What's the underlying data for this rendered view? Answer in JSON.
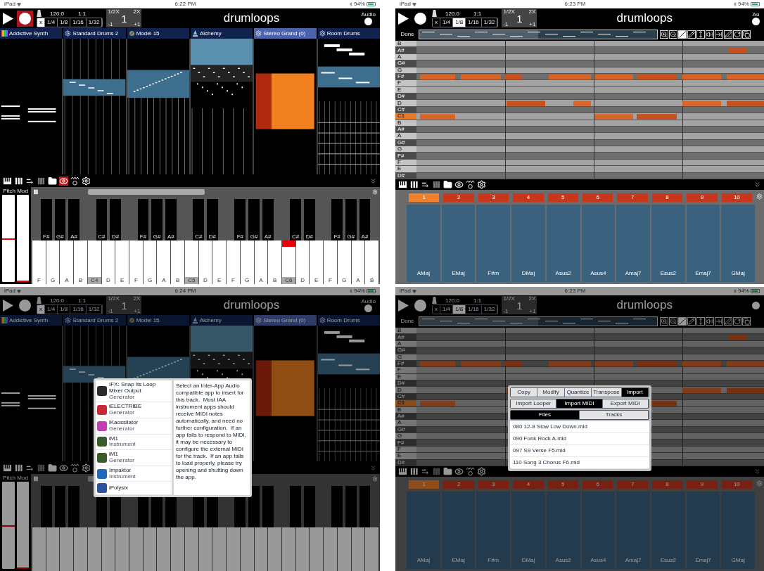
{
  "screens": [
    {
      "kind": "tracks",
      "dimmed": false,
      "status": {
        "device": "iPad",
        "time": "6:22 PM",
        "battery": "94%"
      },
      "toolbar": {
        "recording": true,
        "tempo": "120.0",
        "position": "1:1",
        "grid": [
          {
            "label": "x",
            "selected": true
          },
          {
            "label": "1/4",
            "selected": false
          },
          {
            "label": "1/8",
            "selected": false
          },
          {
            "label": "1/16",
            "selected": false
          },
          {
            "label": "1/32",
            "selected": false
          }
        ],
        "multiplier": {
          "half": "1/2X",
          "double": "2X",
          "value": "1",
          "minus": "-1",
          "plus": "+1"
        },
        "title": "drumloops",
        "audio": "Audio"
      },
      "tracks": [
        {
          "name": "Addictive Synth",
          "kind": "spectrum",
          "selected": false
        },
        {
          "name": "Standard Drums 2",
          "kind": "gear",
          "selected": false
        },
        {
          "name": "Model 15",
          "kind": "dial",
          "selected": false
        },
        {
          "name": "Alchemy",
          "kind": "figure",
          "selected": false
        },
        {
          "name": "Stereo Grand (0)",
          "kind": "gear",
          "selected": true
        },
        {
          "name": "Room Drums",
          "kind": "gear",
          "selected": false
        }
      ],
      "view_icons": [
        {
          "kind": "keys",
          "active": false
        },
        {
          "kind": "bars",
          "active": false
        },
        {
          "kind": "list",
          "active": false
        },
        {
          "kind": "grid",
          "active": false
        },
        {
          "kind": "folder",
          "active": false
        },
        {
          "kind": "wave-eye",
          "active": true
        },
        {
          "kind": "wave-ring",
          "active": false
        },
        {
          "kind": "gear",
          "active": false
        }
      ],
      "keyboard": {
        "pitch": {
          "label": "Pitch",
          "level": 0.5
        },
        "mod": {
          "label": "Mod",
          "level": 0
        },
        "keys": [
          {
            "kind": "white",
            "label": "F",
            "marked": false,
            "pressed": false
          },
          {
            "kind": "black",
            "label": "F#"
          },
          {
            "kind": "white",
            "label": "G",
            "marked": false,
            "pressed": false
          },
          {
            "kind": "black",
            "label": "G#"
          },
          {
            "kind": "white",
            "label": "A",
            "marked": false,
            "pressed": false
          },
          {
            "kind": "black",
            "label": "A#"
          },
          {
            "kind": "white",
            "label": "B",
            "marked": false,
            "pressed": false
          },
          {
            "kind": "white",
            "label": "C4",
            "marked": true,
            "pressed": false
          },
          {
            "kind": "black",
            "label": "C#"
          },
          {
            "kind": "white",
            "label": "D",
            "marked": false,
            "pressed": false
          },
          {
            "kind": "black",
            "label": "D#"
          },
          {
            "kind": "white",
            "label": "E",
            "marked": false,
            "pressed": false
          },
          {
            "kind": "white",
            "label": "F",
            "marked": false,
            "pressed": false
          },
          {
            "kind": "black",
            "label": "F#"
          },
          {
            "kind": "white",
            "label": "G",
            "marked": false,
            "pressed": false
          },
          {
            "kind": "black",
            "label": "G#"
          },
          {
            "kind": "white",
            "label": "A",
            "marked": false,
            "pressed": false
          },
          {
            "kind": "black",
            "label": "A#"
          },
          {
            "kind": "white",
            "label": "B",
            "marked": false,
            "pressed": false
          },
          {
            "kind": "white",
            "label": "C5",
            "marked": true,
            "pressed": false
          },
          {
            "kind": "black",
            "label": "C#"
          },
          {
            "kind": "white",
            "label": "D",
            "marked": false,
            "pressed": false
          },
          {
            "kind": "black",
            "label": "D#"
          },
          {
            "kind": "white",
            "label": "E",
            "marked": false,
            "pressed": false
          },
          {
            "kind": "white",
            "label": "F",
            "marked": false,
            "pressed": false
          },
          {
            "kind": "black",
            "label": "F#"
          },
          {
            "kind": "white",
            "label": "G",
            "marked": false,
            "pressed": false
          },
          {
            "kind": "black",
            "label": "G#"
          },
          {
            "kind": "white",
            "label": "A",
            "marked": false,
            "pressed": false
          },
          {
            "kind": "black",
            "label": "A#"
          },
          {
            "kind": "white",
            "label": "B",
            "marked": false,
            "pressed": false
          },
          {
            "kind": "white",
            "label": "C6",
            "marked": true,
            "pressed": true
          },
          {
            "kind": "black",
            "label": "C#"
          },
          {
            "kind": "white",
            "label": "D",
            "marked": false,
            "pressed": false
          },
          {
            "kind": "black",
            "label": "D#"
          },
          {
            "kind": "white",
            "label": "E",
            "marked": false,
            "pressed": false
          },
          {
            "kind": "white",
            "label": "F",
            "marked": false,
            "pressed": false
          },
          {
            "kind": "black",
            "label": "F#"
          },
          {
            "kind": "white",
            "label": "G",
            "marked": false,
            "pressed": false
          },
          {
            "kind": "black",
            "label": "G#"
          },
          {
            "kind": "white",
            "label": "A",
            "marked": false,
            "pressed": false
          },
          {
            "kind": "black",
            "label": "A#"
          },
          {
            "kind": "white",
            "label": "B",
            "marked": false,
            "pressed": false
          }
        ]
      }
    },
    {
      "kind": "roll",
      "dimmed": false,
      "status": {
        "device": "iPad",
        "time": "6:23 PM",
        "battery": "94%"
      },
      "toolbar": {
        "recording": false,
        "tempo": "120.0",
        "position": "1:1",
        "grid": [
          {
            "label": "x",
            "selected": false
          },
          {
            "label": "1/4",
            "selected": false
          },
          {
            "label": "1/8",
            "selected": true
          },
          {
            "label": "1/16",
            "selected": false
          },
          {
            "label": "1/32",
            "selected": false
          }
        ],
        "multiplier": {
          "half": "1/2X",
          "double": "2X",
          "value": "1",
          "minus": "-1",
          "plus": "+1"
        },
        "title": "drumloops",
        "audio": "Au"
      },
      "done": "Done",
      "tools": [
        {
          "kind": "zoom-in",
          "selected": false
        },
        {
          "kind": "zoom-out",
          "selected": false
        },
        {
          "kind": "line",
          "selected": true
        },
        {
          "kind": "pencil",
          "selected": false
        },
        {
          "kind": "vertical",
          "selected": false
        },
        {
          "kind": "waves",
          "selected": false
        },
        {
          "kind": "to-line",
          "selected": false
        },
        {
          "kind": "pen",
          "selected": false
        },
        {
          "kind": "rotate",
          "selected": false
        },
        {
          "kind": "copy",
          "selected": false
        }
      ],
      "rows": [
        {
          "label": "B",
          "kind": "natural",
          "highlighted": false
        },
        {
          "label": "A#",
          "kind": "sharp",
          "highlighted": false
        },
        {
          "label": "A",
          "kind": "natural",
          "highlighted": false
        },
        {
          "label": "G#",
          "kind": "sharp",
          "highlighted": false
        },
        {
          "label": "G",
          "kind": "natural",
          "highlighted": false
        },
        {
          "label": "F#",
          "kind": "sharp",
          "highlighted": false
        },
        {
          "label": "F",
          "kind": "natural",
          "highlighted": false
        },
        {
          "label": "E",
          "kind": "natural",
          "highlighted": false
        },
        {
          "label": "D#",
          "kind": "sharp",
          "highlighted": false
        },
        {
          "label": "D",
          "kind": "natural",
          "highlighted": false
        },
        {
          "label": "C#",
          "kind": "sharp",
          "highlighted": false
        },
        {
          "label": "C1",
          "kind": "natural",
          "highlighted": true
        },
        {
          "label": "B",
          "kind": "natural",
          "highlighted": false
        },
        {
          "label": "A#",
          "kind": "sharp",
          "highlighted": false
        },
        {
          "label": "A",
          "kind": "natural",
          "highlighted": false
        },
        {
          "label": "G#",
          "kind": "sharp",
          "highlighted": false
        },
        {
          "label": "G",
          "kind": "natural",
          "highlighted": false
        },
        {
          "label": "F#",
          "kind": "sharp",
          "highlighted": false
        },
        {
          "label": "F",
          "kind": "natural",
          "highlighted": false
        },
        {
          "label": "E",
          "kind": "natural",
          "highlighted": false
        },
        {
          "label": "D#",
          "kind": "sharp",
          "highlighted": false
        }
      ],
      "view_icons": [
        {
          "kind": "keys",
          "active": false
        },
        {
          "kind": "bars",
          "active": false
        },
        {
          "kind": "list",
          "active": false
        },
        {
          "kind": "grid",
          "active": false
        },
        {
          "kind": "folder",
          "active": false
        },
        {
          "kind": "wave-eye",
          "active": false
        },
        {
          "kind": "wave-ring",
          "active": false
        },
        {
          "kind": "gear",
          "active": false
        }
      ],
      "pads": [
        {
          "number": "1",
          "chord": "AMaj",
          "selected": true
        },
        {
          "number": "2",
          "chord": "EMaj",
          "selected": false
        },
        {
          "number": "3",
          "chord": "F#m",
          "selected": false
        },
        {
          "number": "4",
          "chord": "DMaj",
          "selected": false
        },
        {
          "number": "5",
          "chord": "Asus2",
          "selected": false
        },
        {
          "number": "6",
          "chord": "Asus4",
          "selected": false
        },
        {
          "number": "7",
          "chord": "Amaj7",
          "selected": false
        },
        {
          "number": "8",
          "chord": "Esus2",
          "selected": false
        },
        {
          "number": "9",
          "chord": "Emaj7",
          "selected": false
        },
        {
          "number": "10",
          "chord": "GMaj",
          "selected": false
        }
      ]
    },
    {
      "kind": "tracks",
      "dimmed": true,
      "status": {
        "device": "iPad",
        "time": "6:24 PM",
        "battery": "94%"
      },
      "toolbar": {
        "recording": false,
        "tempo": "120.0",
        "position": "1:1",
        "grid": [
          {
            "label": "x",
            "selected": true
          },
          {
            "label": "1/4",
            "selected": false
          },
          {
            "label": "1/8",
            "selected": false
          },
          {
            "label": "1/16",
            "selected": false
          },
          {
            "label": "1/32",
            "selected": false
          }
        ],
        "multiplier": {
          "half": "1/2X",
          "double": "2X",
          "value": "1",
          "minus": "-1",
          "plus": "+1"
        },
        "title": "drumloops",
        "audio": "Audio"
      },
      "tracks": [
        {
          "name": "Addictive Synth",
          "kind": "spectrum",
          "selected": false
        },
        {
          "name": "Standard Drums 2",
          "kind": "gear",
          "selected": false
        },
        {
          "name": "Model 15",
          "kind": "dial",
          "selected": false
        },
        {
          "name": "Alchemy",
          "kind": "figure",
          "selected": false
        },
        {
          "name": "Stereo Grand (0)",
          "kind": "gear",
          "selected": true
        },
        {
          "name": "Room Drums",
          "kind": "gear",
          "selected": false
        }
      ],
      "view_icons": [
        {
          "kind": "keys",
          "active": false
        },
        {
          "kind": "bars",
          "active": false
        },
        {
          "kind": "list",
          "active": false
        },
        {
          "kind": "grid",
          "active": false
        },
        {
          "kind": "folder",
          "active": false
        },
        {
          "kind": "wave-eye",
          "active": false
        },
        {
          "kind": "wave-ring",
          "active": false
        },
        {
          "kind": "gear",
          "active": false
        }
      ],
      "keyboard": {
        "pitch": {
          "label": "Pitch",
          "level": 0.5
        },
        "mod": {
          "label": "Mod",
          "level": 0
        },
        "keys": [
          {
            "kind": "white",
            "marked": false,
            "pressed": false
          },
          {
            "kind": "black"
          },
          {
            "kind": "white",
            "marked": false,
            "pressed": false
          },
          {
            "kind": "black"
          },
          {
            "kind": "white",
            "marked": false,
            "pressed": false
          },
          {
            "kind": "black"
          },
          {
            "kind": "white",
            "marked": false,
            "pressed": false
          },
          {
            "kind": "white",
            "marked": false,
            "pressed": false
          },
          {
            "kind": "black"
          },
          {
            "kind": "white",
            "marked": false,
            "pressed": false
          },
          {
            "kind": "black"
          },
          {
            "kind": "white",
            "marked": false,
            "pressed": false
          },
          {
            "kind": "white",
            "marked": false,
            "pressed": false
          },
          {
            "kind": "black"
          },
          {
            "kind": "white",
            "marked": false,
            "pressed": false
          },
          {
            "kind": "black"
          },
          {
            "kind": "white",
            "marked": false,
            "pressed": false
          },
          {
            "kind": "black"
          },
          {
            "kind": "white",
            "marked": false,
            "pressed": false
          },
          {
            "kind": "white",
            "marked": false,
            "pressed": false
          },
          {
            "kind": "black"
          },
          {
            "kind": "white",
            "marked": false,
            "pressed": false
          },
          {
            "kind": "black"
          },
          {
            "kind": "white",
            "marked": false,
            "pressed": false
          },
          {
            "kind": "white",
            "marked": false,
            "pressed": false
          },
          {
            "kind": "black"
          },
          {
            "kind": "white",
            "marked": false,
            "pressed": false
          },
          {
            "kind": "black"
          },
          {
            "kind": "white",
            "marked": false,
            "pressed": false
          },
          {
            "kind": "black"
          },
          {
            "kind": "white",
            "marked": false,
            "pressed": false
          },
          {
            "kind": "white",
            "marked": false,
            "pressed": false
          },
          {
            "kind": "black"
          },
          {
            "kind": "white",
            "marked": false,
            "pressed": false
          },
          {
            "kind": "black"
          },
          {
            "kind": "white",
            "marked": false,
            "pressed": false
          },
          {
            "kind": "white",
            "marked": false,
            "pressed": false
          },
          {
            "kind": "black"
          },
          {
            "kind": "white",
            "marked": false,
            "pressed": false
          },
          {
            "kind": "black"
          },
          {
            "kind": "white",
            "marked": false,
            "pressed": false
          },
          {
            "kind": "black"
          },
          {
            "kind": "white",
            "marked": false,
            "pressed": false
          }
        ]
      },
      "popup": {
        "kind": "apps",
        "items": [
          {
            "name": "IFX: Snap Its Loop Mixer Output",
            "type": "Generator",
            "color": "#2a2a2a"
          },
          {
            "name": "iELECTRIBE",
            "type": "Generator",
            "color": "#c8283a"
          },
          {
            "name": "iKaossilator",
            "type": "Generator",
            "color": "#c040b0"
          },
          {
            "name": "iM1",
            "type": "Instrument",
            "color": "#3b5a2a"
          },
          {
            "name": "iM1",
            "type": "Generator",
            "color": "#3b5a2a"
          },
          {
            "name": "Impaktor",
            "type": "Instrument",
            "color": "#1e6ab8"
          },
          {
            "name": "iPolysix",
            "color": "#3050a0"
          }
        ],
        "note": "Select an Inter-App Audio compatible app to insert for this track.  Most IAA instrument apps should receive MIDI notes automatically, and need no further configuration.  If an app fails to respond to MIDI, it may be necessary to configure the external MIDI for the track.  If an app fails to load properly, please try opening and shutting down the app."
      }
    },
    {
      "kind": "roll",
      "dimmed": true,
      "status": {
        "device": "iPad",
        "time": "6:23 PM",
        "battery": "94%"
      },
      "toolbar": {
        "recording": false,
        "tempo": "120.0",
        "position": "1:1",
        "grid": [
          {
            "label": "x",
            "selected": false
          },
          {
            "label": "1/4",
            "selected": false
          },
          {
            "label": "1/8",
            "selected": true
          },
          {
            "label": "1/16",
            "selected": false
          },
          {
            "label": "1/32",
            "selected": false
          }
        ],
        "multiplier": {
          "half": "1/2X",
          "double": "2X",
          "value": "1",
          "minus": "-1",
          "plus": "+1"
        },
        "title": "drumloops"
      },
      "done": "Done",
      "tools": [
        {
          "kind": "zoom-in",
          "selected": false
        },
        {
          "kind": "zoom-out",
          "selected": false
        },
        {
          "kind": "line",
          "selected": true
        },
        {
          "kind": "pencil",
          "selected": false
        },
        {
          "kind": "vertical",
          "selected": false
        },
        {
          "kind": "waves",
          "selected": false
        },
        {
          "kind": "to-line",
          "selected": false
        },
        {
          "kind": "pen",
          "selected": false
        },
        {
          "kind": "rotate",
          "selected": false
        },
        {
          "kind": "copy",
          "selected": false
        }
      ],
      "rows": [
        {
          "label": "B",
          "kind": "natural",
          "highlighted": false
        },
        {
          "label": "A#",
          "kind": "sharp",
          "highlighted": false
        },
        {
          "label": "A",
          "kind": "natural",
          "highlighted": false
        },
        {
          "label": "G#",
          "kind": "sharp",
          "highlighted": false
        },
        {
          "label": "G",
          "kind": "natural",
          "highlighted": false
        },
        {
          "label": "F#",
          "kind": "sharp",
          "highlighted": false
        },
        {
          "label": "F",
          "kind": "natural",
          "highlighted": false
        },
        {
          "label": "E",
          "kind": "natural",
          "highlighted": false
        },
        {
          "label": "D#",
          "kind": "sharp",
          "highlighted": false
        },
        {
          "label": "D",
          "kind": "natural",
          "highlighted": false
        },
        {
          "label": "C#",
          "kind": "sharp",
          "highlighted": false
        },
        {
          "label": "C1",
          "kind": "natural",
          "highlighted": true
        },
        {
          "label": "B",
          "kind": "natural",
          "highlighted": false
        },
        {
          "label": "A#",
          "kind": "sharp",
          "highlighted": false
        },
        {
          "label": "A",
          "kind": "natural",
          "highlighted": false
        },
        {
          "label": "G#",
          "kind": "sharp",
          "highlighted": false
        },
        {
          "label": "G",
          "kind": "natural",
          "highlighted": false
        },
        {
          "label": "F#",
          "kind": "sharp",
          "highlighted": false
        },
        {
          "label": "F",
          "kind": "natural",
          "highlighted": false
        },
        {
          "label": "E",
          "kind": "natural",
          "highlighted": false
        },
        {
          "label": "D#",
          "kind": "sharp",
          "highlighted": false
        }
      ],
      "view_icons": [
        {
          "kind": "keys",
          "active": false
        },
        {
          "kind": "bars",
          "active": false
        },
        {
          "kind": "list",
          "active": false
        },
        {
          "kind": "grid",
          "active": false
        },
        {
          "kind": "folder",
          "active": false
        },
        {
          "kind": "wave-eye",
          "active": false
        },
        {
          "kind": "wave-ring",
          "active": false
        },
        {
          "kind": "gear",
          "active": false
        }
      ],
      "pads": [
        {
          "number": "1",
          "chord": "AMaj",
          "selected": true
        },
        {
          "number": "2",
          "chord": "EMaj",
          "selected": false
        },
        {
          "number": "3",
          "chord": "F#m",
          "selected": false
        },
        {
          "number": "4",
          "chord": "DMaj",
          "selected": false
        },
        {
          "number": "5",
          "chord": "Asus2",
          "selected": false
        },
        {
          "number": "6",
          "chord": "Asus4",
          "selected": false
        },
        {
          "number": "7",
          "chord": "Amaj7",
          "selected": false
        },
        {
          "number": "8",
          "chord": "Esus2",
          "selected": false
        },
        {
          "number": "9",
          "chord": "Emaj7",
          "selected": false
        },
        {
          "number": "10",
          "chord": "GMaj",
          "selected": false
        }
      ],
      "popup": {
        "kind": "import",
        "tabs": [
          {
            "label": "Copy",
            "selected": false
          },
          {
            "label": "Modify",
            "selected": false
          },
          {
            "label": "Quantize",
            "selected": false
          },
          {
            "label": "Transpose",
            "selected": false
          },
          {
            "label": "Import",
            "selected": true
          }
        ],
        "subtabs": [
          {
            "label": "Import Looper",
            "selected": false
          },
          {
            "label": "Import MIDI",
            "selected": true
          },
          {
            "label": "Export MIDI",
            "selected": false
          }
        ],
        "sources": [
          {
            "label": "Files",
            "selected": true
          },
          {
            "label": "Tracks",
            "selected": false
          }
        ],
        "files": [
          "080 12-8 Slow Low Down.mid",
          "090 Funk Rock A.mid",
          "097 S9 Verse F5.mid",
          "110 Song 3 Chorus F6.mid"
        ]
      }
    }
  ]
}
